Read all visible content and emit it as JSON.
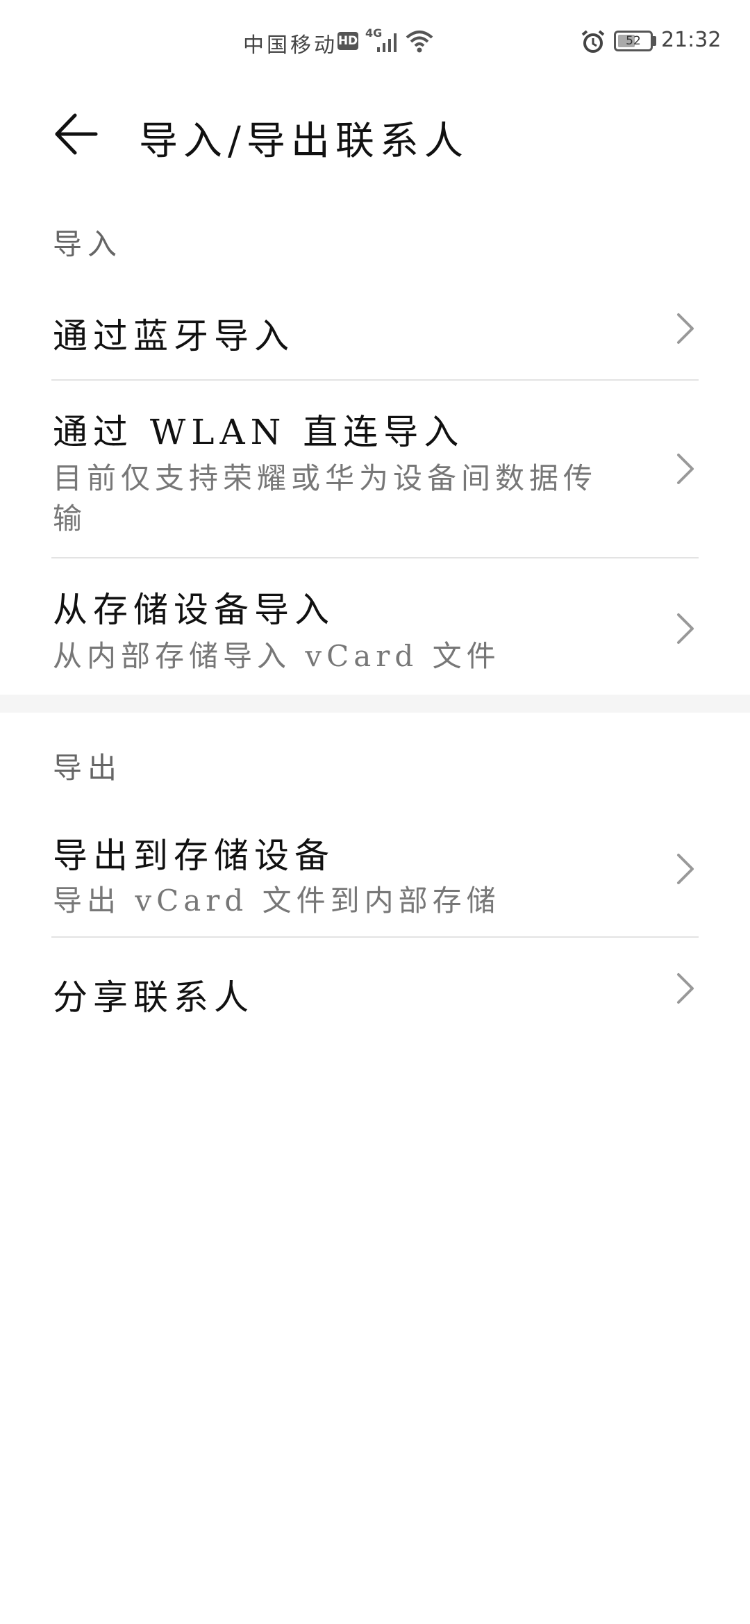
{
  "status_bar": {
    "carrier": "中国移动",
    "hd": "HD",
    "network": "4G",
    "battery": "52",
    "time": "21:32"
  },
  "header": {
    "title": "导入/导出联系人"
  },
  "import_section": {
    "label": "导入",
    "items": [
      {
        "title": "通过蓝牙导入",
        "subtitle": ""
      },
      {
        "title": "通过 WLAN 直连导入",
        "subtitle": "目前仅支持荣耀或华为设备间数据传输"
      },
      {
        "title": "从存储设备导入",
        "subtitle": "从内部存储导入 vCard 文件"
      }
    ]
  },
  "export_section": {
    "label": "导出",
    "items": [
      {
        "title": "导出到存储设备",
        "subtitle": "导出 vCard 文件到内部存储"
      },
      {
        "title": "分享联系人",
        "subtitle": ""
      }
    ]
  }
}
